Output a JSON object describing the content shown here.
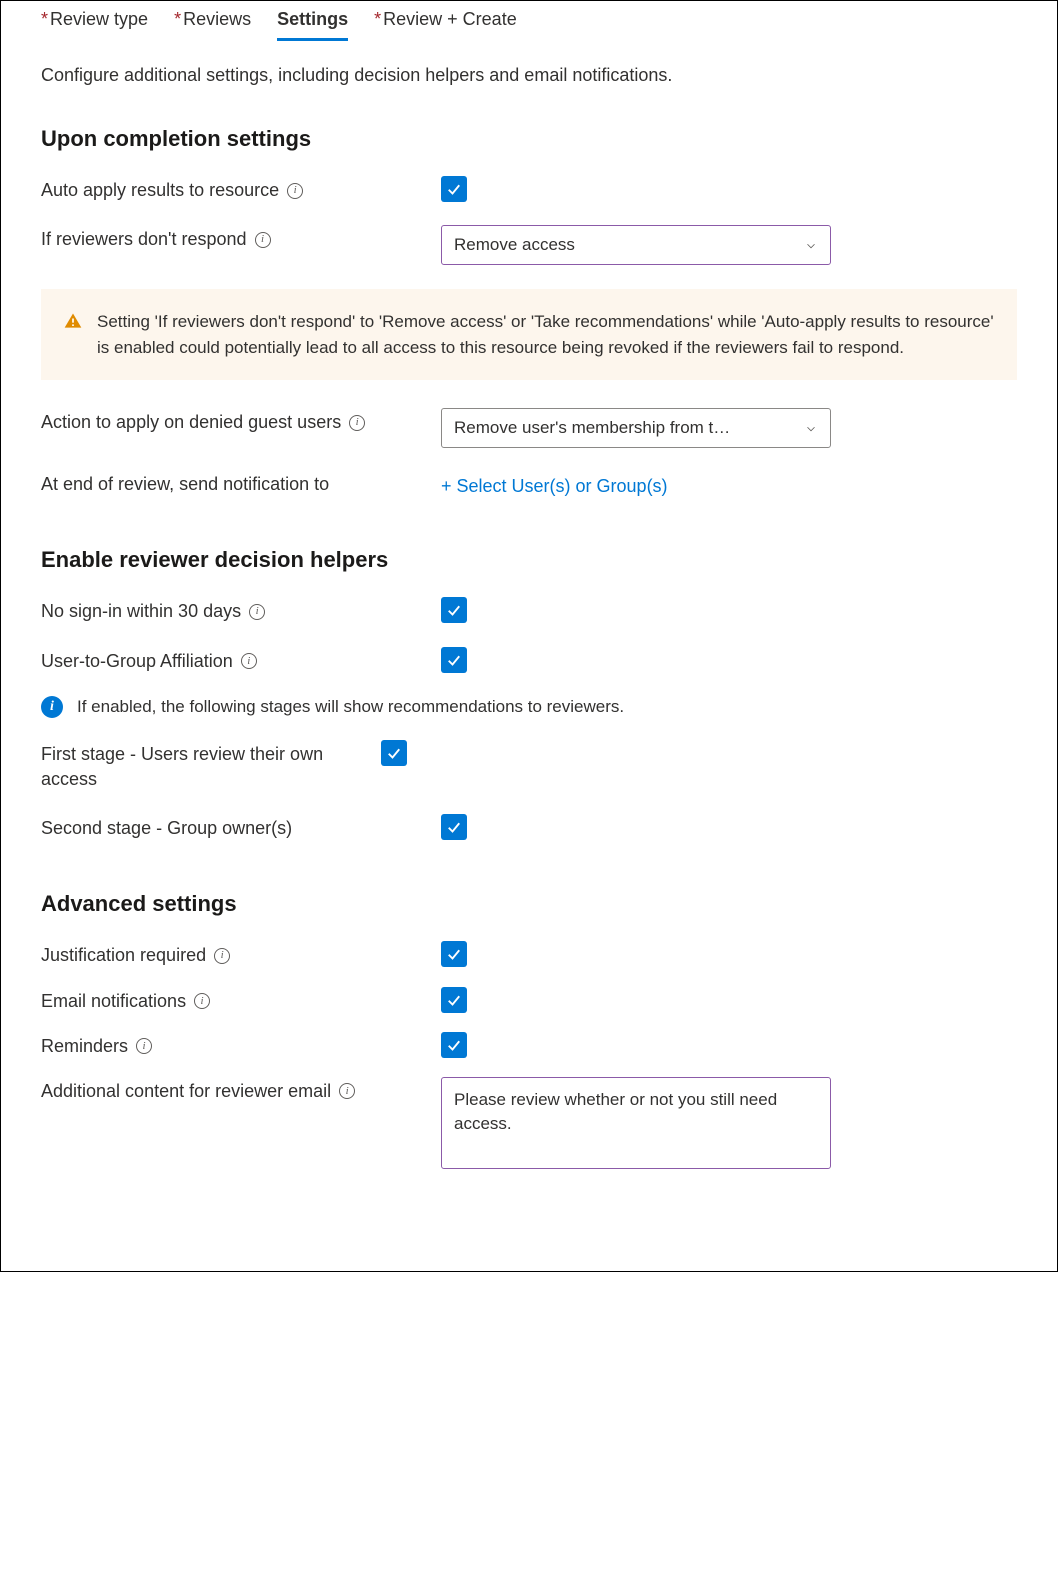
{
  "tabs": [
    {
      "label": "Review type",
      "required": true
    },
    {
      "label": "Reviews",
      "required": true
    },
    {
      "label": "Settings",
      "required": false
    },
    {
      "label": "Review + Create",
      "required": true
    }
  ],
  "intro": "Configure additional settings, including decision helpers and email notifications.",
  "sections": {
    "completion": {
      "heading": "Upon completion settings",
      "auto_apply_label": "Auto apply results to resource",
      "no_respond_label": "If reviewers don't respond",
      "no_respond_value": "Remove access",
      "warning": "Setting 'If reviewers don't respond' to 'Remove access' or 'Take recommendations' while 'Auto-apply results to resource' is enabled could potentially lead to all access to this resource being revoked if the reviewers fail to respond.",
      "denied_guest_label": "Action to apply on denied guest users",
      "denied_guest_value": "Remove user's membership from t…",
      "notify_label": "At end of review, send notification to",
      "notify_link": "+ Select User(s) or Group(s)"
    },
    "helpers": {
      "heading": "Enable reviewer decision helpers",
      "no_signin_label": "No sign-in within 30 days",
      "affiliation_label": "User-to-Group Affiliation",
      "info": "If enabled, the following stages will show recommendations to reviewers.",
      "stage1_label": "First stage - Users review their own access",
      "stage2_label": "Second stage - Group owner(s)"
    },
    "advanced": {
      "heading": "Advanced settings",
      "justification_label": "Justification required",
      "email_label": "Email notifications",
      "reminders_label": "Reminders",
      "additional_label": "Additional content for reviewer email",
      "additional_value": "Please review whether or not you still need access."
    }
  }
}
